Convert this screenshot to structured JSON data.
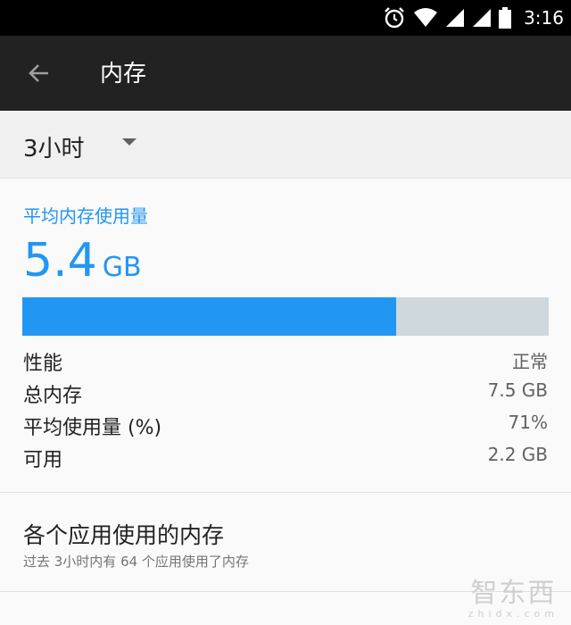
{
  "status_bar": {
    "time": "3:16",
    "icons": [
      "alarm-icon",
      "wifi-icon",
      "signal-icon",
      "signal-icon",
      "battery-icon"
    ]
  },
  "app_bar": {
    "title": "内存",
    "back_icon": "arrow-left-icon"
  },
  "filter": {
    "selected": "3小时"
  },
  "summary": {
    "label": "平均内存使用量",
    "value": "5.4",
    "unit": "GB",
    "usage_fraction": 0.71
  },
  "stats": [
    {
      "label": "性能",
      "value": "正常"
    },
    {
      "label": "总内存",
      "value": "7.5 GB"
    },
    {
      "label": "平均使用量 (%)",
      "value": "71%"
    },
    {
      "label": "可用",
      "value": "2.2 GB"
    }
  ],
  "apps_section": {
    "title": "各个应用使用的内存",
    "subtitle": "过去 3小时内有 64 个应用使用了内存"
  },
  "watermark": {
    "text": "智东西",
    "subtext": "zhidx.com"
  },
  "colors": {
    "accent": "#2196f3",
    "bar_track": "#cfd8dc",
    "app_bar": "#222222"
  }
}
